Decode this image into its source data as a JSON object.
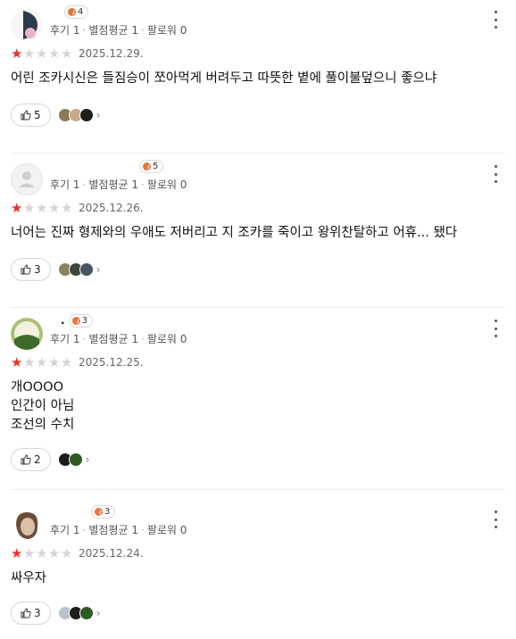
{
  "reviews": [
    {
      "name": "",
      "level": "4",
      "stats": [
        "후기 1",
        "별점평균 1",
        "팔로워 0"
      ],
      "rating": 1,
      "date": "2025.12.29.",
      "text": [
        "어린 조카시신은 들짐승이 쪼아먹게 버려두고 따뜻한 볕에 풀이불덮으니 좋으냐"
      ],
      "likes": "5",
      "avatar_colors": [
        "#ffffff",
        "#2d3a4a",
        "#e8b4c8"
      ],
      "liker_colors": [
        "#8a7a55",
        "#c9a98a",
        "#1e1e1e"
      ]
    },
    {
      "name": "",
      "level": "5",
      "stats": [
        "후기 1",
        "별점평균 1",
        "팔로워 0"
      ],
      "rating": 1,
      "date": "2025.12.26.",
      "text": [
        "너어는 진짜 형제와의 우애도 저버리고 지 조카를 죽이고 왕위찬탈하고 어휴... 됐다"
      ],
      "likes": "3",
      "avatar_colors": [
        "#f1f1f1",
        "#c9c9c9",
        "#dedede"
      ],
      "liker_colors": [
        "#8a8160",
        "#3c4a3a",
        "#4a5563"
      ]
    },
    {
      "name": ".",
      "level": "3",
      "stats": [
        "후기 1",
        "별점평균 1",
        "팔로워 0"
      ],
      "rating": 1,
      "date": "2025.12.25.",
      "text": [
        "개OOOO",
        "인간이 아님",
        "조선의 수치"
      ],
      "likes": "2",
      "avatar_colors": [
        "#f4f0e0",
        "#3e6b2a",
        "#a7c070"
      ],
      "liker_colors": [
        "#1b1b1b",
        "#2e5a24"
      ]
    },
    {
      "name": "",
      "level": "3",
      "stats": [
        "후기 1",
        "별점평균 1",
        "팔로워 0"
      ],
      "rating": 1,
      "date": "2025.12.24.",
      "text": [
        "싸우자"
      ],
      "likes": "3",
      "avatar_colors": [
        "#ffffff",
        "#6b4e3a",
        "#d9c0a8"
      ],
      "liker_colors": [
        "#b9c3d0",
        "#1f1f1f",
        "#2c5a28"
      ]
    }
  ]
}
